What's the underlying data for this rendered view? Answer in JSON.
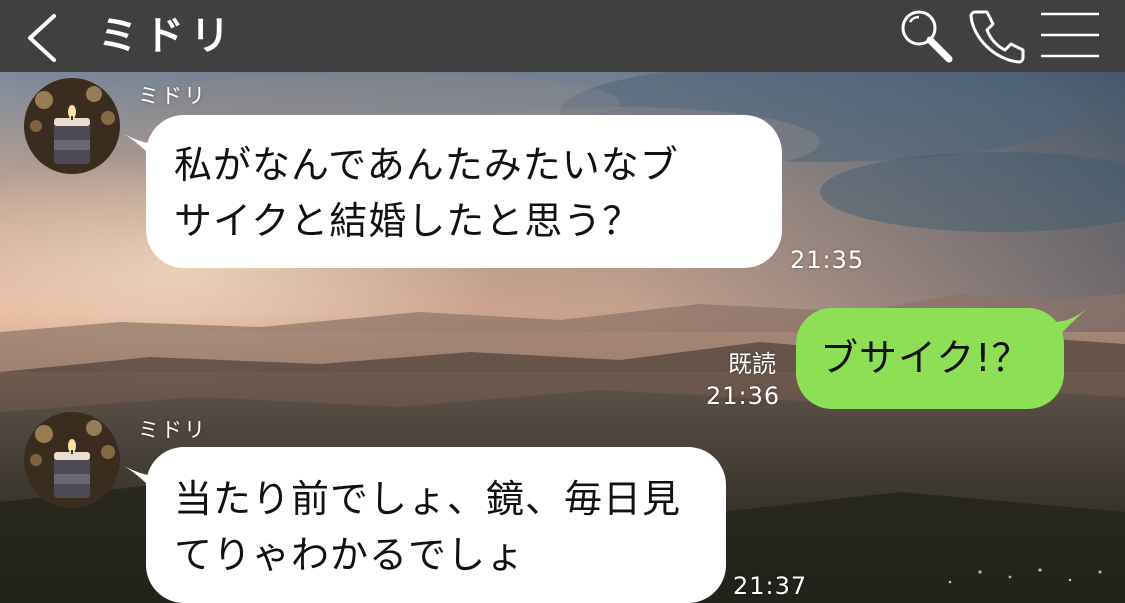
{
  "header": {
    "title": "ミドリ",
    "icons": [
      "chevron-left-icon",
      "search-icon",
      "phone-icon",
      "menu-icon"
    ],
    "background": "#404040"
  },
  "messages": [
    {
      "direction": "incoming",
      "sender": "ミドリ",
      "lines": [
        "私がなんであんたみたいなブ",
        "サイクと結婚したと思う？"
      ],
      "time": "21:35"
    },
    {
      "direction": "outgoing",
      "lines": [
        "ブサイク!？"
      ],
      "read_label": "既読",
      "time": "21:36"
    },
    {
      "direction": "incoming",
      "sender": "ミドリ",
      "lines": [
        "当たり前でしょ、鏡、毎日見",
        "てりゃわかるでしょ"
      ],
      "time": "21:37"
    }
  ],
  "colors": {
    "incoming_bubble": "#ffffff",
    "outgoing_bubble": "#8de055",
    "text": "#111111",
    "meta_text": "#ffffff"
  }
}
